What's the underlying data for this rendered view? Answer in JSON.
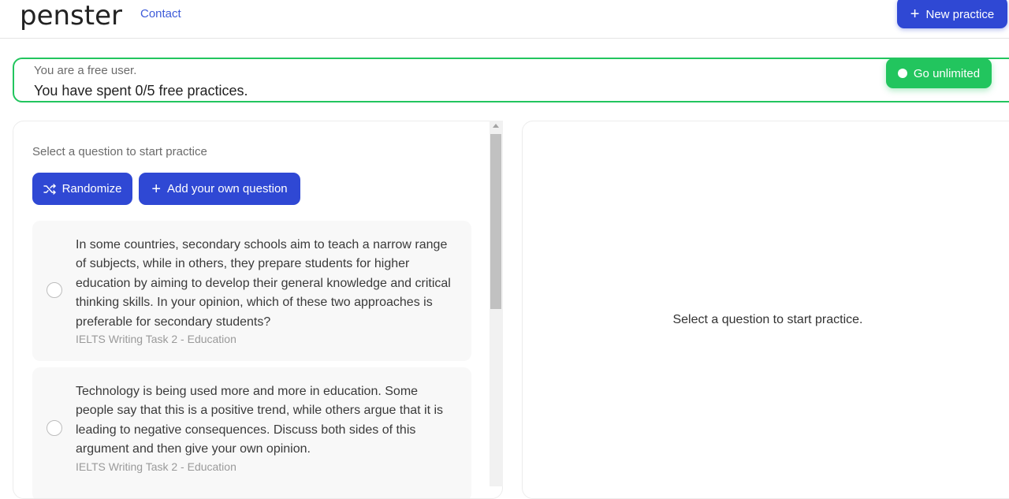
{
  "header": {
    "logo": "penster",
    "nav_contact": "Contact",
    "new_practice_label": "New practice"
  },
  "banner": {
    "subtitle": "You are a free user.",
    "message": "You have spent 0/5 free practices.",
    "go_unlimited_label": "Go unlimited"
  },
  "questions_panel": {
    "hint": "Select a question to start practice",
    "randomize_label": "Randomize",
    "add_question_label": "Add your own question",
    "questions": [
      {
        "text": "In some countries, secondary schools aim to teach a narrow range of subjects, while in others, they prepare students for higher education by aiming to develop their general knowledge and critical thinking skills. In your opinion, which of these two approaches is preferable for secondary students?",
        "meta": "IELTS Writing Task 2 - Education"
      },
      {
        "text": "Technology is being used more and more in education. Some people say that this is a positive trend, while others argue that it is leading to negative consequences. Discuss both sides of this argument and then give your own opinion.",
        "meta": "IELTS Writing Task 2 - Education"
      }
    ]
  },
  "practice_panel": {
    "empty_message": "Select a question to start practice."
  },
  "colors": {
    "primary": "#2f48d4",
    "success": "#22c55e",
    "link": "#3d5bd9"
  },
  "icons": {
    "new_practice": "plus-icon",
    "go_unlimited": "dot-icon",
    "randomize": "shuffle-icon",
    "add_question": "plus-icon"
  }
}
